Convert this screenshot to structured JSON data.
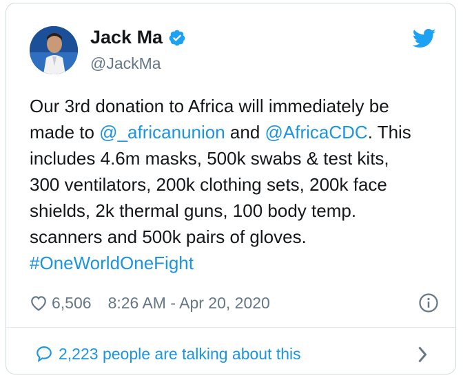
{
  "author": {
    "name": "Jack Ma",
    "handle": "@JackMa",
    "verified": true
  },
  "tweet": {
    "segments": [
      {
        "text": "Our 3rd donation to Africa will immediately be",
        "link": false,
        "br": true
      },
      {
        "text": "made to ",
        "link": false
      },
      {
        "text": "@_africanunion",
        "link": true
      },
      {
        "text": " and ",
        "link": false
      },
      {
        "text": "@AfricaCDC",
        "link": true
      },
      {
        "text": ". This",
        "link": false,
        "br": true
      },
      {
        "text": "includes 4.6m masks, 500k swabs & test kits,",
        "link": false,
        "br": true
      },
      {
        "text": "300 ventilators, 200k clothing sets, 200k face",
        "link": false,
        "br": true
      },
      {
        "text": "shields, 2k thermal guns, 100 body temp.",
        "link": false,
        "br": true
      },
      {
        "text": "scanners and 500k pairs of gloves.",
        "link": false,
        "br": true
      },
      {
        "text": "#OneWorldOneFight",
        "link": true
      }
    ],
    "likes": "6,506",
    "timestamp": "8:26 AM - Apr 20, 2020"
  },
  "footer": {
    "talking": "2,223 people are talking about this"
  },
  "colors": {
    "link": "#1b95e0",
    "muted": "#657786",
    "border": "#cfd9de"
  },
  "icons": [
    "verified-badge-icon",
    "twitter-bird-icon",
    "heart-icon",
    "info-icon",
    "speech-bubble-icon",
    "chevron-right-icon"
  ]
}
